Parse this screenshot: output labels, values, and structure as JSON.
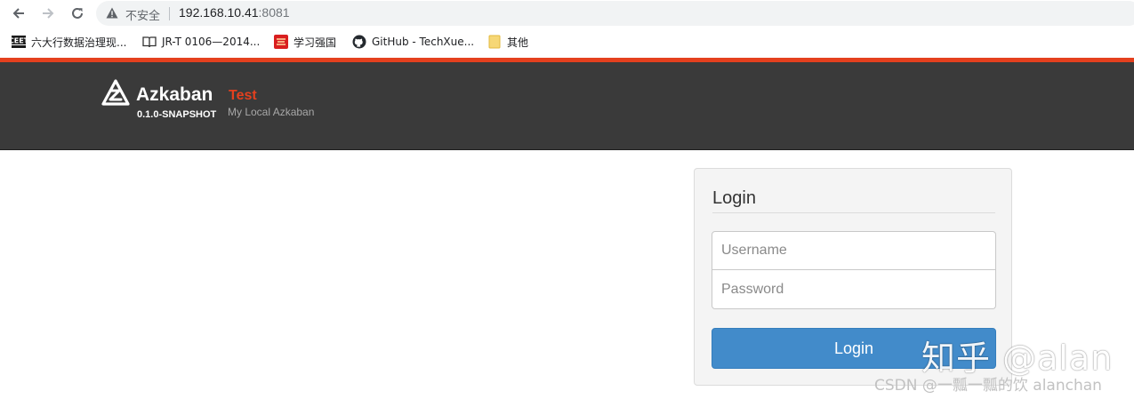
{
  "browser": {
    "security_text": "不安全",
    "url_host": "192.168.10.41",
    "url_port": ":8081",
    "bookmarks": [
      {
        "label": "六大行数据治理现...",
        "icon": "ceet-site-icon"
      },
      {
        "label": "JR-T 0106—2014...",
        "icon": "book-icon"
      },
      {
        "label": "学习强国",
        "icon": "xuexi-qiangguo-icon"
      },
      {
        "label": "GitHub - TechXue...",
        "icon": "github-icon"
      },
      {
        "label": "其他",
        "icon": "folder-icon"
      }
    ]
  },
  "header": {
    "app_name": "Azkaban",
    "version": "0.1.0-SNAPSHOT",
    "env_name": "Test",
    "env_desc": "My Local Azkaban"
  },
  "login": {
    "title": "Login",
    "username_placeholder": "Username",
    "password_placeholder": "Password",
    "button_label": "Login"
  },
  "watermarks": {
    "zhihu": "知乎 @alan",
    "csdn": "CSDN @一瓢一瓢的饮 alanchan"
  },
  "colors": {
    "accent": "#e4401e",
    "header_bg": "#3a3a3a",
    "primary_button": "#428bca"
  }
}
